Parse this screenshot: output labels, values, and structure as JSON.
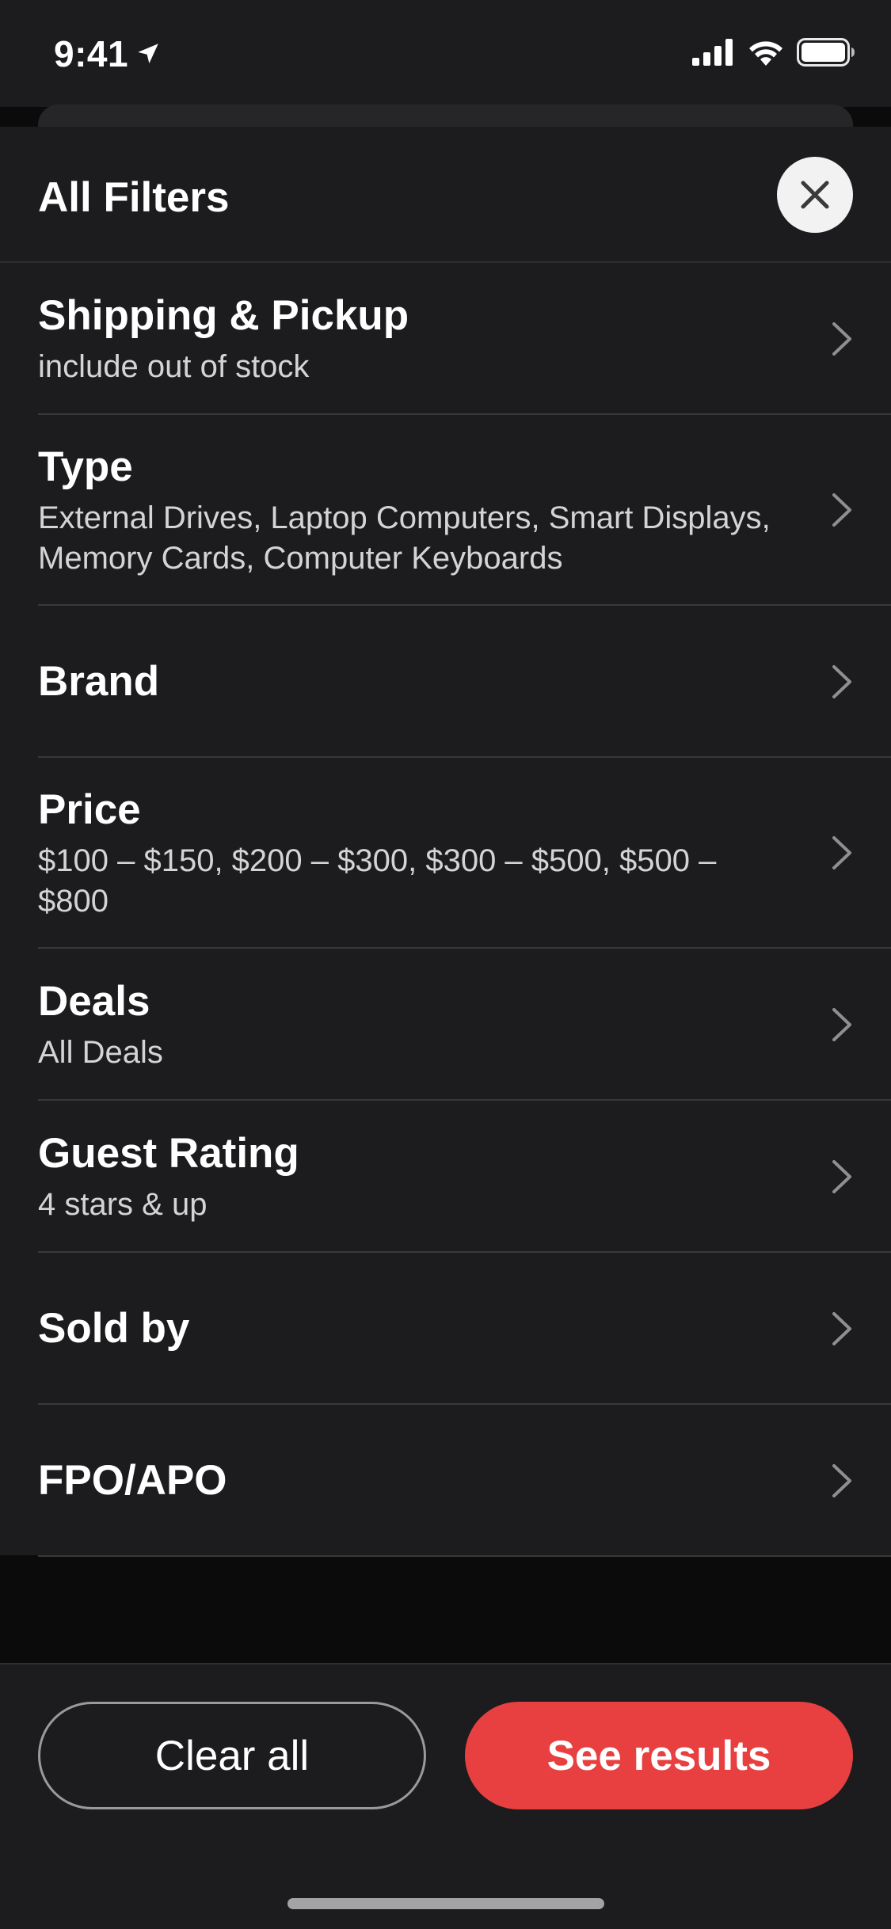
{
  "status_bar": {
    "time": "9:41",
    "icons": [
      "location-arrow-icon",
      "signal-icon",
      "wifi-icon",
      "battery-icon"
    ]
  },
  "sheet": {
    "title": "All Filters",
    "close_icon": "close-icon"
  },
  "filters": [
    {
      "label": "Shipping & Pickup",
      "value": "include out of stock"
    },
    {
      "label": "Type",
      "value": "External Drives, Laptop Computers, Smart Displays, Memory Cards, Computer Keyboards"
    },
    {
      "label": "Brand",
      "value": ""
    },
    {
      "label": "Price",
      "value": "$100  –  $150, $200  –  $300, $300  –  $500, $500  –  $800"
    },
    {
      "label": "Deals",
      "value": "All Deals"
    },
    {
      "label": "Guest Rating",
      "value": "4 stars & up"
    },
    {
      "label": "Sold by",
      "value": ""
    },
    {
      "label": "FPO/APO",
      "value": ""
    }
  ],
  "footer": {
    "clear_label": "Clear all",
    "results_label": "See results"
  },
  "colors": {
    "accent": "#e84040",
    "background": "#1c1c1e"
  }
}
